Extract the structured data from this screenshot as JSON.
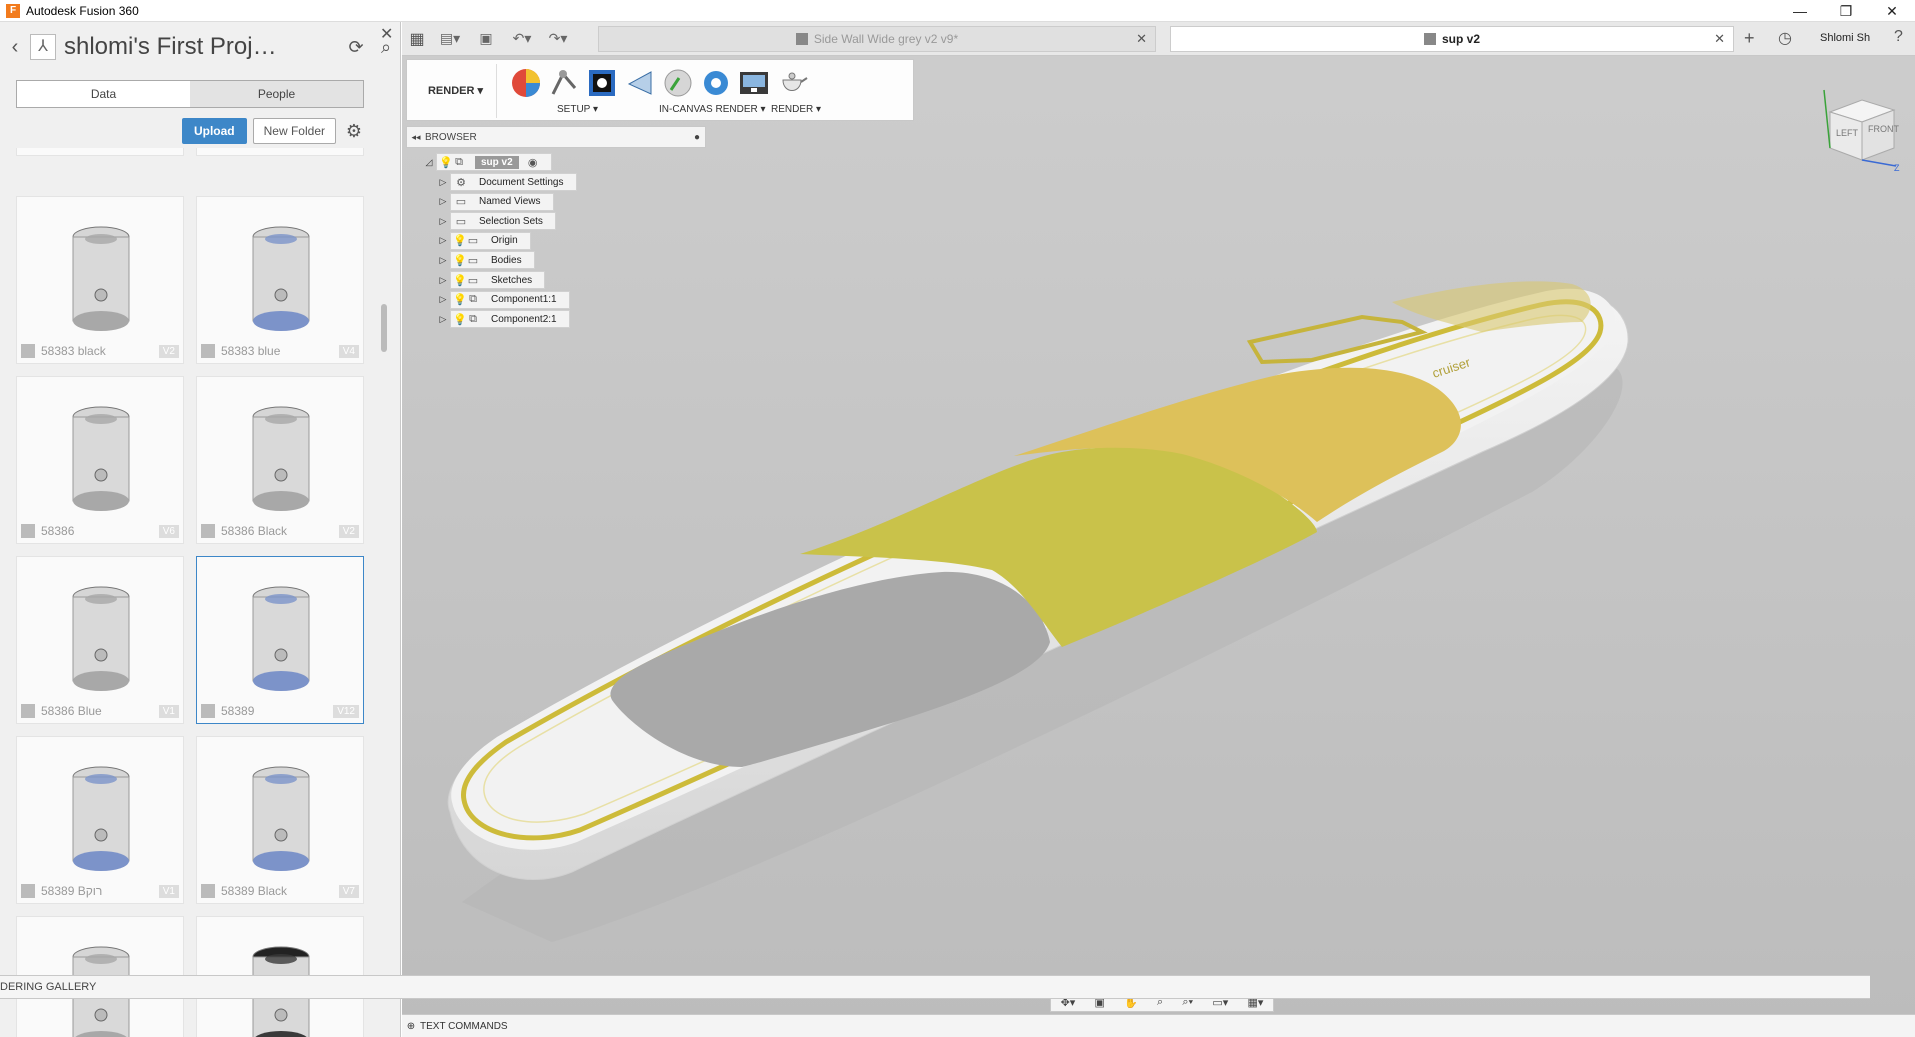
{
  "window": {
    "title": "Autodesk Fusion 360",
    "controls": [
      "—",
      "❐",
      "✕"
    ]
  },
  "data_panel": {
    "project_title": "shlomi's First Proj…",
    "tabs": [
      {
        "label": "Data",
        "active": true
      },
      {
        "label": "People",
        "active": false
      }
    ],
    "upload_label": "Upload",
    "new_folder_label": "New Folder",
    "files": [
      {
        "name": "58383 black",
        "version": "V2",
        "selected": false,
        "color": "grey"
      },
      {
        "name": "58383 blue",
        "version": "V4",
        "selected": false,
        "color": "blue"
      },
      {
        "name": "58386",
        "version": "V6",
        "selected": false,
        "color": "grey"
      },
      {
        "name": "58386 Black",
        "version": "V2",
        "selected": false,
        "color": "grey"
      },
      {
        "name": "58386 Blue",
        "version": "V1",
        "selected": false,
        "color": "grey"
      },
      {
        "name": "58389",
        "version": "V12",
        "selected": true,
        "color": "blue"
      },
      {
        "name": "58389 Bרוק",
        "version": "V1",
        "selected": false,
        "color": "blue"
      },
      {
        "name": "58389 Black",
        "version": "V7",
        "selected": false,
        "color": "blue"
      },
      {
        "name": "",
        "version": "",
        "selected": false,
        "color": "grey"
      },
      {
        "name": "",
        "version": "",
        "selected": false,
        "color": "dark"
      }
    ]
  },
  "gallery_bar": {
    "label": "DERING GALLERY"
  },
  "tabs": {
    "documents": [
      {
        "label": "Side Wall Wide grey v2 v9*",
        "active": false
      },
      {
        "label": "sup v2",
        "active": true
      }
    ],
    "user": "Shlomi Sh"
  },
  "ribbon": {
    "workspace": "RENDER",
    "groups": [
      {
        "label": "SETUP"
      },
      {
        "label": "IN-CANVAS RENDER"
      },
      {
        "label": "RENDER"
      }
    ]
  },
  "browser": {
    "label": "BROWSER",
    "root": "sup v2",
    "nodes": [
      {
        "label": "Document Settings",
        "icon": "gear-icon",
        "bulb": null
      },
      {
        "label": "Named Views",
        "icon": "folder-icon",
        "bulb": null
      },
      {
        "label": "Selection Sets",
        "icon": "folder-icon",
        "bulb": null
      },
      {
        "label": "Origin",
        "icon": "folder-icon",
        "bulb": "blue"
      },
      {
        "label": "Bodies",
        "icon": "folder-icon",
        "bulb": "yellow"
      },
      {
        "label": "Sketches",
        "icon": "folder-icon",
        "bulb": "blue"
      },
      {
        "label": "Component1:1",
        "icon": "component-icon",
        "bulb": "yellow"
      },
      {
        "label": "Component2:1",
        "icon": "component-icon",
        "bulb": "yellow"
      }
    ]
  },
  "viewcube": {
    "faces": [
      "LEFT",
      "FRONT"
    ],
    "axis": "Z"
  },
  "statusbar": {
    "label": "TEXT COMMANDS"
  },
  "colors": {
    "accent": "#3d87c8",
    "board_yellow": "#c9c24a",
    "board_orange": "#e0c25a",
    "board_grey": "#a8a8a8",
    "canvas_bg": "#c4c4c4"
  }
}
